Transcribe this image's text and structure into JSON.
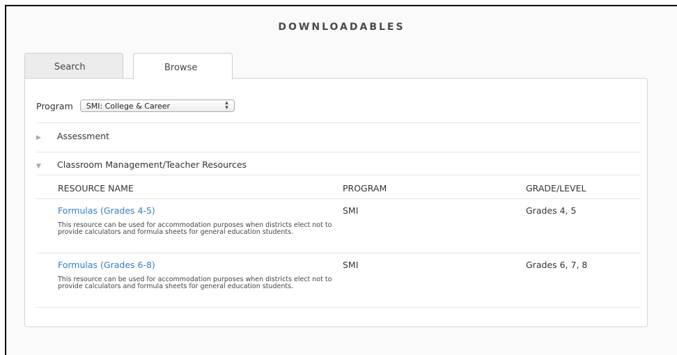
{
  "page": {
    "title": "DOWNLOADABLES"
  },
  "tabs": [
    {
      "label": "Search",
      "active": false
    },
    {
      "label": "Browse",
      "active": true
    }
  ],
  "filter": {
    "label": "Program",
    "selected": "SMI: College & Career",
    "arrow_icon": "up-down-arrows-icon"
  },
  "accordion": [
    {
      "label": "Assessment",
      "expanded": false,
      "icon": "triangle-right-icon"
    },
    {
      "label": "Classroom Management/Teacher Resources",
      "expanded": true,
      "icon": "triangle-down-icon"
    }
  ],
  "table": {
    "headers": [
      "RESOURCE NAME",
      "PROGRAM",
      "GRADE/LEVEL"
    ],
    "rows": [
      {
        "name": "Formulas (Grades 4-5)",
        "description": "This resource can be used for accommodation purposes when districts elect not to provide calculators and formula sheets for general education students.",
        "program": "SMI",
        "grade": "Grades 4, 5"
      },
      {
        "name": "Formulas (Grades 6-8)",
        "description": "This resource can be used for accommodation purposes when districts elect not to provide calculators and formula sheets for general education students.",
        "program": "SMI",
        "grade": "Grades 6, 7, 8"
      }
    ]
  },
  "colors": {
    "link": "#2f7ec7",
    "border": "#d4d4d4"
  }
}
